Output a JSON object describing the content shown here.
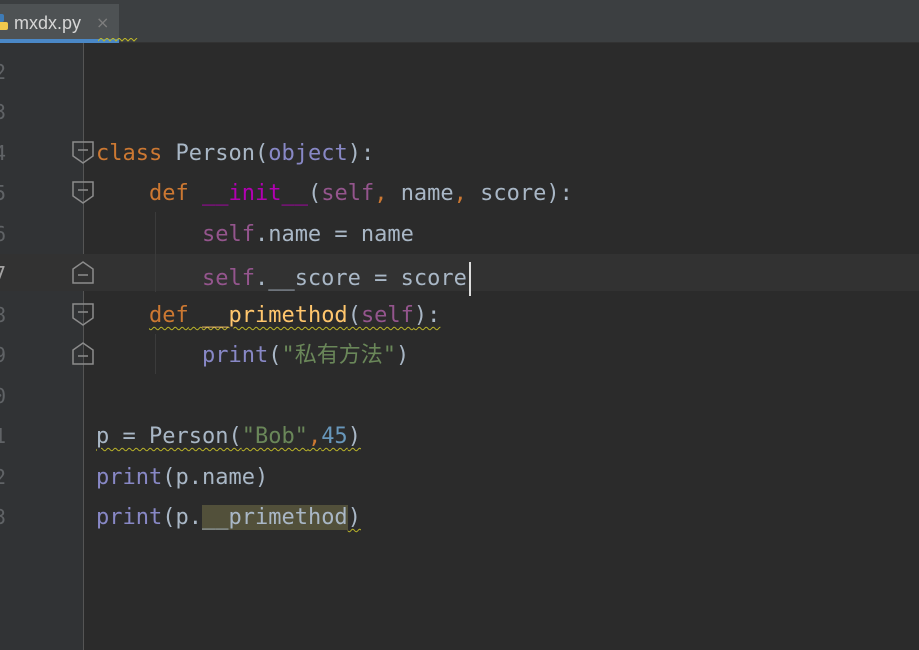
{
  "tab": {
    "filename": "mxdx.py",
    "close_glyph": "×",
    "icon": "python-file-icon"
  },
  "line_numbers": [
    "2",
    "3",
    "4",
    "5",
    "6",
    "7",
    "8",
    "9",
    "0",
    "1",
    "2",
    "3"
  ],
  "active_line_index": 5,
  "code": {
    "l4": {
      "kw": "class",
      "name": "Person",
      "paren_open": "(",
      "base": "object",
      "paren_close_colon": "):"
    },
    "l5": {
      "kw": "def",
      "name": "__init__",
      "open": "(",
      "self": "self",
      "c1": ",",
      "p1": "name",
      "c2": ",",
      "p2": "score",
      "close": "):"
    },
    "l6": {
      "self": "self",
      "rest": ".name = name"
    },
    "l7": {
      "self": "self",
      "rest": ".__score = score"
    },
    "l8": {
      "kw": "def",
      "name": "__primethod",
      "open": "(",
      "self": "self",
      "close": "):"
    },
    "l9": {
      "builtin": "print",
      "open": "(",
      "str": "\"私有方法\"",
      "close": ")"
    },
    "l11": {
      "lhs": "p = Person(",
      "str": "\"Bob\"",
      "comma": ",",
      "num": "45",
      "close": ")"
    },
    "l12": {
      "builtin": "print",
      "rest": "(p.name)"
    },
    "l13": {
      "builtin": "print",
      "open": "(p.",
      "usage": "__primethod",
      "close": ")"
    }
  },
  "colors": {
    "background": "#2b2b2b",
    "keyword": "#cc7832",
    "self": "#94558d",
    "string": "#6a8759",
    "number": "#6897bb",
    "builtin": "#8888c6",
    "function": "#ffc66d",
    "magic": "#b200b2"
  }
}
